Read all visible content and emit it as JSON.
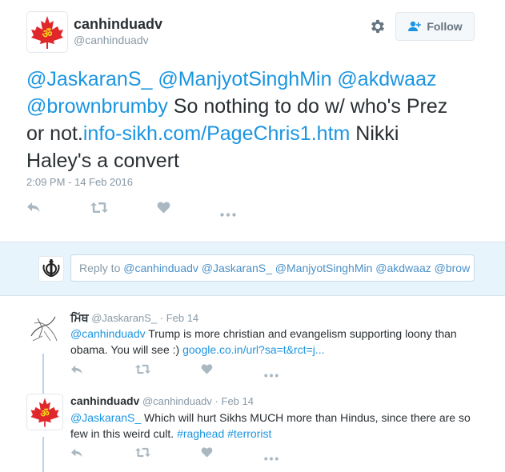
{
  "main_tweet": {
    "display_name": "canhinduadv",
    "handle": "@canhinduadv",
    "follow_label": "Follow",
    "text_mentions": "@JaskaranS_ @ManjyotSinghMin @akdwaaz",
    "text_mention4": "@brownbrumby",
    "text_part1": " So nothing to do w/ who's Prez",
    "text_part2": "or not.",
    "text_link": "info-sikh.com/PageChris1.htm",
    "text_part3": " Nikki",
    "text_part4": "Haley's a convert",
    "timestamp": "2:09 PM - 14 Feb 2016"
  },
  "reply_box": {
    "to_label": "Reply to ",
    "mentions": "@canhinduadv @JaskaranS_ @ManjyotSinghMin @akdwaaz @brow"
  },
  "replies": [
    {
      "display_name": "ਮਿੱਥ",
      "handle": "@JaskaranS_",
      "separator": "·",
      "date": "Feb 14",
      "mention": "@canhinduadv",
      "text1": " Trump is more christian and evangelism supporting loony than",
      "text2": "obama. You will see :) ",
      "link": "google.co.in/url?sa=t&rct=j..."
    },
    {
      "display_name": "canhinduadv",
      "handle": "@canhinduadv",
      "separator": "·",
      "date": "Feb 14",
      "mention": "@JaskaranS_",
      "text1": " Which will hurt Sikhs MUCH more than Hindus, since there are so",
      "text2": "few in this weird cult. ",
      "hashtag1": "#raghead",
      "hashtag2": "#terrorist"
    }
  ],
  "icons": {
    "avatar_main": "maple-leaf-om-icon",
    "avatar_reply_box": "khanda-icon",
    "avatar_reply1": "sketch-avatar-icon",
    "avatar_reply2": "maple-leaf-om-icon",
    "settings": "gear-icon",
    "follow": "add-user-icon",
    "reply": "reply-arrow-icon",
    "retweet": "retweet-icon",
    "like": "heart-icon",
    "more": "more-dots-icon"
  },
  "colors": {
    "link": "#1b95e0",
    "maple_red": "#e0282b",
    "reply_box_bg": "#e8f4fb",
    "action_gray": "#aab8c2"
  }
}
